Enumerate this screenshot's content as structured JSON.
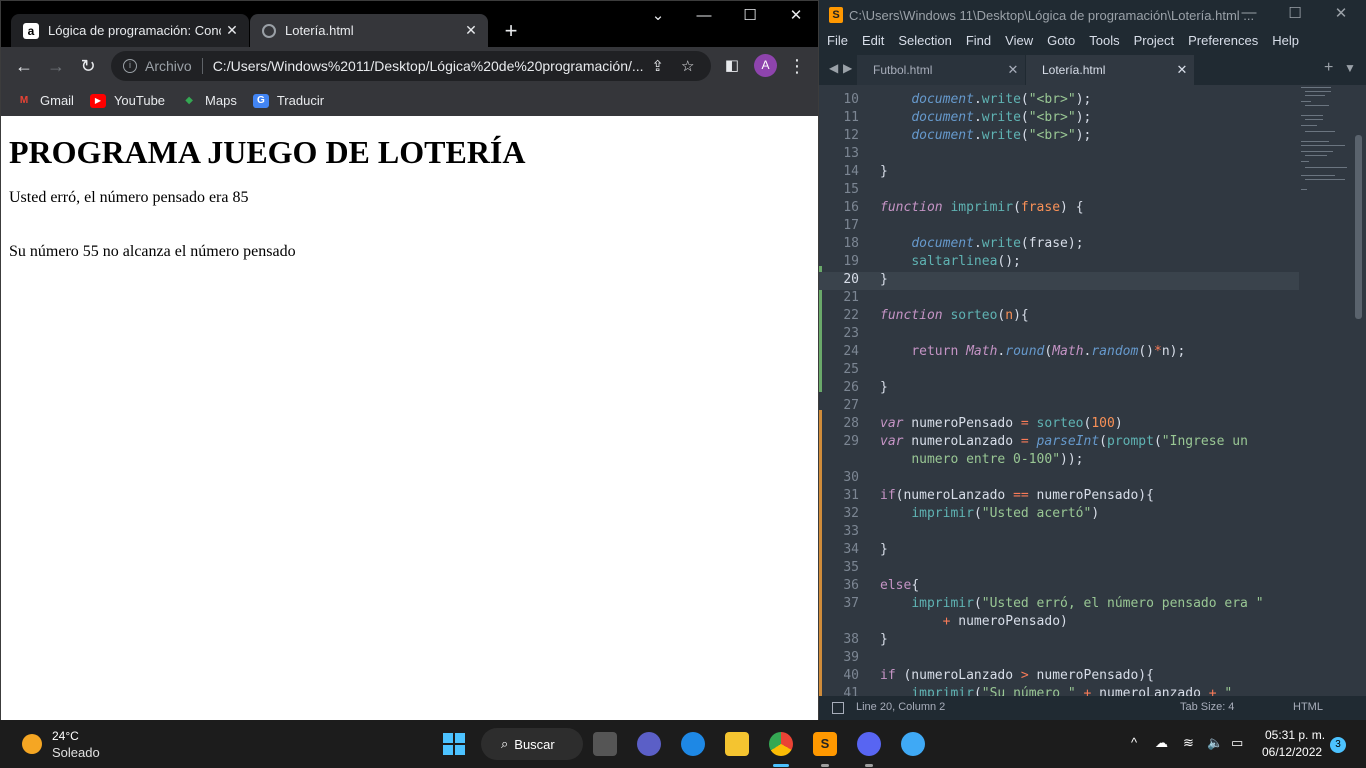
{
  "browser": {
    "tabs": [
      {
        "title": "Lógica de programación: Concep",
        "favicon": "a"
      },
      {
        "title": "Lotería.html"
      }
    ],
    "address": {
      "chip": "Archivo",
      "url": "C:/Users/Windows%2011/Desktop/Lógica%20de%20programación/..."
    },
    "bookmarks": [
      {
        "label": "Gmail",
        "icon": "gmail-icon",
        "glyph": "M",
        "color": "#ea4335"
      },
      {
        "label": "YouTube",
        "icon": "youtube-icon",
        "glyph": "▶",
        "color": "#ff0000"
      },
      {
        "label": "Maps",
        "icon": "maps-icon",
        "glyph": "◆",
        "color": "#34a853"
      },
      {
        "label": "Traducir",
        "icon": "translate-icon",
        "glyph": "G",
        "color": "#4285f4"
      }
    ],
    "avatar": "A",
    "page": {
      "heading": "PROGRAMA JUEGO DE LOTERÍA",
      "line1": "Usted erró, el número pensado era 85",
      "line2": "Su número 55 no alcanza el número pensado"
    }
  },
  "editor": {
    "title": "C:\\Users\\Windows 11\\Desktop\\Lógica de programación\\Lotería.html ...",
    "menu": [
      "File",
      "Edit",
      "Selection",
      "Find",
      "View",
      "Goto",
      "Tools",
      "Project",
      "Preferences",
      "Help"
    ],
    "tabs": [
      {
        "label": "Futbol.html",
        "active": false
      },
      {
        "label": "Lotería.html",
        "active": true
      }
    ],
    "active_line": 20,
    "lines": [
      {
        "n": "10",
        "html": "    <span class='obj'>document</span>.<span class='fn'>write</span>(<span class='str'>\"&lt;br&gt;\"</span>);"
      },
      {
        "n": "11",
        "html": "    <span class='obj'>document</span>.<span class='fn'>write</span>(<span class='str'>\"&lt;br&gt;\"</span>);"
      },
      {
        "n": "12",
        "html": "    <span class='obj'>document</span>.<span class='fn'>write</span>(<span class='str'>\"&lt;br&gt;\"</span>);"
      },
      {
        "n": "13",
        "html": ""
      },
      {
        "n": "14",
        "html": "}"
      },
      {
        "n": "15",
        "html": ""
      },
      {
        "n": "16",
        "html": "<span class='kw'>function</span> <span class='fn'>imprimir</span>(<span class='par'>frase</span>) {"
      },
      {
        "n": "17",
        "html": ""
      },
      {
        "n": "18",
        "html": "    <span class='obj'>document</span>.<span class='fn'>write</span>(frase);"
      },
      {
        "n": "19",
        "html": "    <span class='fn'>saltarlinea</span>();"
      },
      {
        "n": "20",
        "html": "}"
      },
      {
        "n": "21",
        "html": ""
      },
      {
        "n": "22",
        "html": "<span class='kw'>function</span> <span class='fn'>sorteo</span>(<span class='par'>n</span>){"
      },
      {
        "n": "23",
        "html": ""
      },
      {
        "n": "24",
        "html": "    <span class='k2'>return</span> <span class='bi2'>Math</span>.<span class='obj'>round</span>(<span class='bi2'>Math</span>.<span class='obj'>random</span>()<span class='op'>*</span>n);"
      },
      {
        "n": "25",
        "html": ""
      },
      {
        "n": "26",
        "html": "}"
      },
      {
        "n": "27",
        "html": ""
      },
      {
        "n": "28",
        "html": "<span class='kw'>var</span> numeroPensado <span class='op'>=</span> <span class='fn'>sorteo</span>(<span class='num'>100</span>)"
      },
      {
        "n": "29",
        "html": "<span class='kw'>var</span> numeroLanzado <span class='op'>=</span> <span class='obj'>parseInt</span>(<span class='fn'>prompt</span>(<span class='str'>\"Ingrese un</span>"
      },
      {
        "n": "",
        "html": "    <span class='str'>numero entre 0-100\"</span>));"
      },
      {
        "n": "30",
        "html": ""
      },
      {
        "n": "31",
        "html": "<span class='k2'>if</span>(numeroLanzado <span class='op'>==</span> numeroPensado){"
      },
      {
        "n": "32",
        "html": "    <span class='fn'>imprimir</span>(<span class='str'>\"Usted acertó\"</span>)"
      },
      {
        "n": "33",
        "html": ""
      },
      {
        "n": "34",
        "html": "}"
      },
      {
        "n": "35",
        "html": ""
      },
      {
        "n": "36",
        "html": "<span class='k2'>else</span>{"
      },
      {
        "n": "37",
        "html": "    <span class='fn'>imprimir</span>(<span class='str'>\"Usted erró, el número pensado era \"</span>"
      },
      {
        "n": "",
        "html": "        <span class='op'>+</span> numeroPensado)"
      },
      {
        "n": "38",
        "html": "}"
      },
      {
        "n": "39",
        "html": ""
      },
      {
        "n": "40",
        "html": "<span class='k2'>if</span> (numeroLanzado <span class='op'>&gt;</span> numeroPensado){"
      },
      {
        "n": "41",
        "html": "    <span class='fn'>imprimir</span>(<span class='str'>\"Su número \"</span> <span class='op'>+</span> numeroLanzado <span class='op'>+</span> <span class='str'>\"</span>"
      }
    ],
    "status": {
      "position": "Line 20, Column 2",
      "tab_size": "Tab Size: 4",
      "syntax": "HTML"
    }
  },
  "taskbar": {
    "weather": {
      "temp": "24°C",
      "condition": "Soleado"
    },
    "search_label": "Buscar",
    "time": "05:31 p. m.",
    "date": "06/12/2022",
    "notifications": "3"
  }
}
